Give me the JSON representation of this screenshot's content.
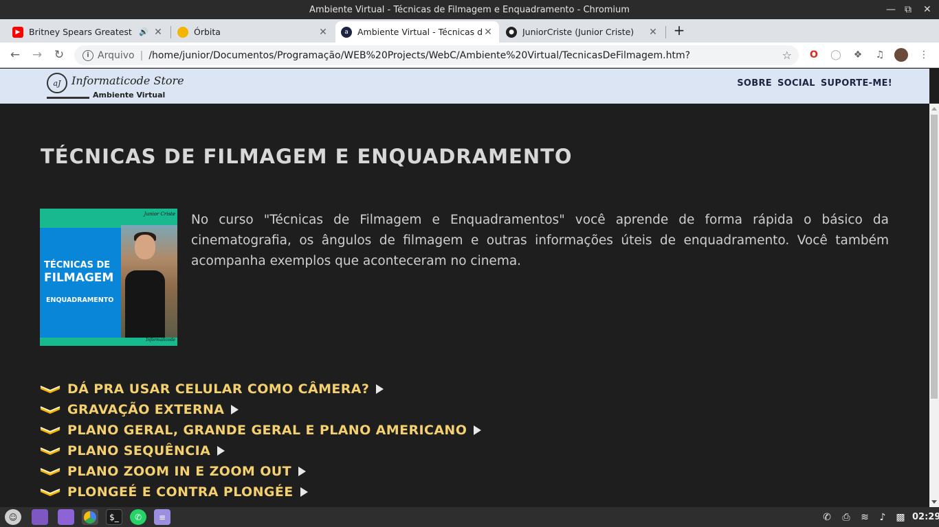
{
  "window": {
    "title": "Ambiente Virtual - Técnicas de Filmagem e Enquadramento - Chromium"
  },
  "tabs": [
    {
      "label": "Britney Spears Greatest Hits",
      "icon": "youtube-icon",
      "color": "#ff0000"
    },
    {
      "label": "Órbita",
      "icon": "orbita-icon",
      "color": "#f4b400"
    },
    {
      "label": "Ambiente Virtual - Técnicas de Filmagem",
      "icon": "informaticode-icon",
      "color": "#1b2540"
    },
    {
      "label": "JuniorCriste (Junior Criste)",
      "icon": "github-icon",
      "color": "#202124"
    }
  ],
  "toolbar": {
    "scheme_label": "Arquivo",
    "url": "/home/junior/Documentos/Programação/WEB%20Projects/WebC/Ambiente%20Virtual/TecnicasDeFilmagem.htm?"
  },
  "site": {
    "logo_name": "Informaticode Store",
    "logo_sub": "Ambiente Virtual",
    "logo_mark": "aJ",
    "nav": [
      "SOBRE",
      "SOCIAL",
      "SUPORTE-ME!"
    ]
  },
  "content": {
    "title": "TÉCNICAS DE FILMAGEM E ENQUADRAMENTO",
    "thumbnail": {
      "line1": "TÉCNICAS DE",
      "line2": "FILMAGEM",
      "line3": "ENQUADRAMENTO",
      "signature": "Junior Criste",
      "brand": "Informaticode"
    },
    "description": "No curso \"Técnicas de Filmagem e Enquadramentos\" você aprende de forma rápida o básico da cinematografia, os ângulos de filmagem e outras informações úteis de enquadramento. Você também acompanha exemplos que aconteceram no cinema.",
    "topics": [
      "DÁ PRA USAR CELULAR COMO CÂMERA?",
      "GRAVAÇÃO EXTERNA",
      "PLANO GERAL, GRANDE GERAL E PLANO AMERICANO",
      "PLANO SEQUÊNCIA",
      "PLANO ZOOM IN E ZOOM OUT",
      "PLONGEÉ E CONTRA PLONGÉE"
    ]
  },
  "colors": {
    "accent_yellow": "#f4d06f",
    "header_bg": "#dbe5f4",
    "page_bg": "#1e1e1e"
  },
  "taskbar": {
    "clock": "02:29"
  }
}
